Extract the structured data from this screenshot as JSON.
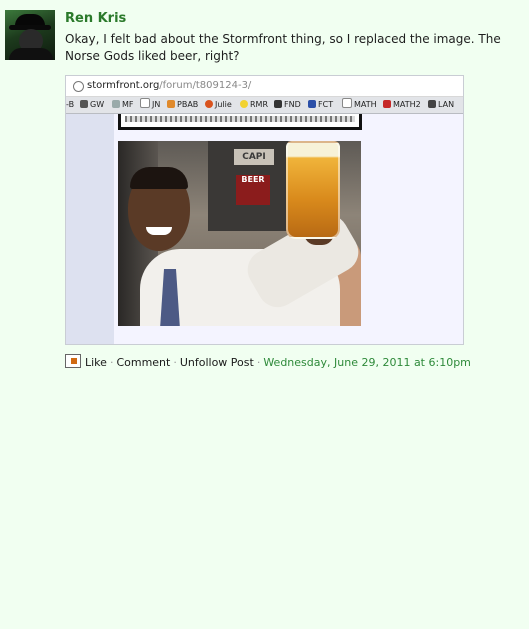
{
  "post": {
    "author": "Ren Kris",
    "message": "Okay, I felt bad about the Stormfront thing, so I replaced the image. The Norse Gods liked beer, right?",
    "image": {
      "url_host": "stormfront.org",
      "url_path": "/forum/t809124-3/",
      "bookmarks": [
        {
          "label": "-B",
          "icon": "bookmark-icon"
        },
        {
          "label": "GW",
          "icon": "gw-icon"
        },
        {
          "label": "MF",
          "icon": "mf-icon"
        },
        {
          "label": "JN",
          "icon": "page-icon"
        },
        {
          "label": "PBAB",
          "icon": "pbab-icon"
        },
        {
          "label": "Julie",
          "icon": "julie-icon"
        },
        {
          "label": "RMR",
          "icon": "bulb-icon"
        },
        {
          "label": "FND",
          "icon": "fnd-icon"
        },
        {
          "label": "FCT",
          "icon": "fct-icon"
        },
        {
          "label": "MATH",
          "icon": "page-icon"
        },
        {
          "label": "MATH2",
          "icon": "math2-icon"
        },
        {
          "label": "LAN",
          "icon": "lan-icon"
        }
      ],
      "photo_sign_top": "CAPI",
      "photo_sign_red": "BEER"
    },
    "actions": {
      "like": "Like",
      "comment": "Comment",
      "unfollow": "Unfollow Post",
      "separator": "·",
      "timestamp": "Wednesday, June 29, 2011 at 6:10pm"
    }
  },
  "colors": {
    "background": "#f1fff1",
    "author": "#2b7a2b",
    "timestamp": "#2e8a3a"
  }
}
